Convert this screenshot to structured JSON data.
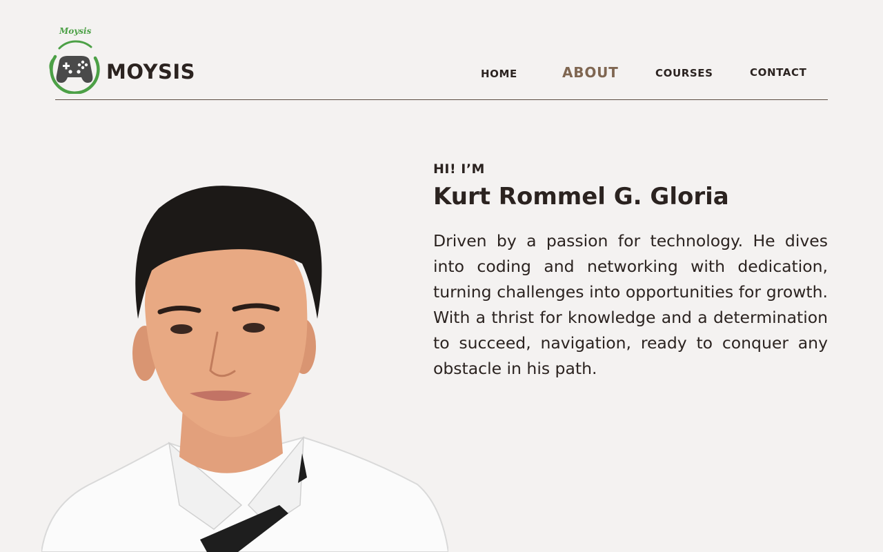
{
  "brand": {
    "script_name": "Moysis",
    "name": "MOYSIS",
    "accent_color": "#4ca046",
    "icon": "gamepad-icon"
  },
  "nav": {
    "home": "HOME",
    "about": "ABOUT",
    "courses": "COURSES",
    "contact": "CONTACT",
    "active": "ABOUT",
    "active_color": "#7f6651"
  },
  "about": {
    "greeting": "HI! I’M",
    "name": "Kurt Rommel G. Gloria",
    "bio": "Driven by a passion for technology. He dives into coding and networking with dedication, turning challenges into opportunities for growth. With a thrist for knowledge and a determination to succeed, navigation, ready to conquer any obstacle in his path."
  },
  "portrait": {
    "icon": "portrait-photo"
  }
}
